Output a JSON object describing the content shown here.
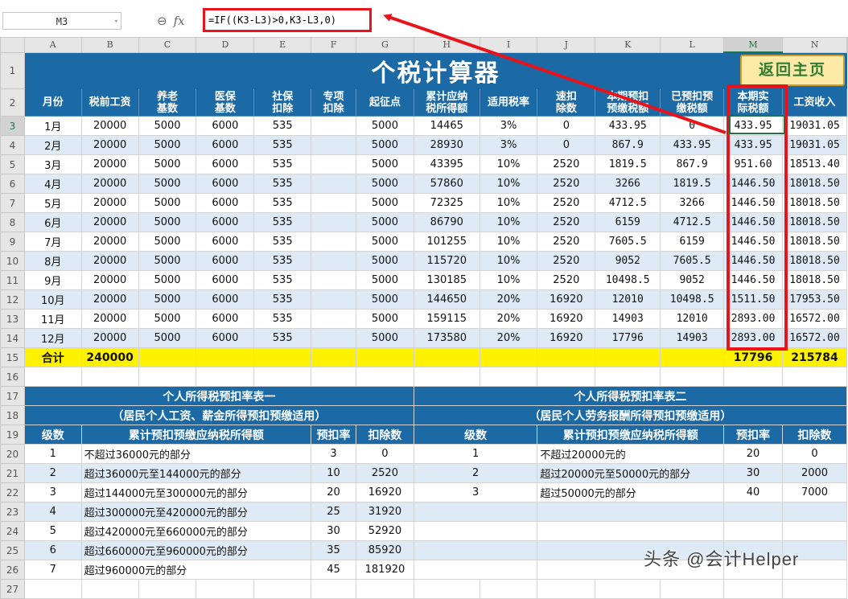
{
  "formula_bar": {
    "name_box": "M3",
    "formula": "=IF((K3-L3)>0,K3-L3,0)"
  },
  "columns": [
    "A",
    "B",
    "C",
    "D",
    "E",
    "F",
    "G",
    "H",
    "I",
    "J",
    "K",
    "L",
    "M",
    "N"
  ],
  "rows": [
    "1",
    "2",
    "3",
    "4",
    "5",
    "6",
    "7",
    "8",
    "9",
    "10",
    "11",
    "12",
    "13",
    "14",
    "15",
    "16",
    "17",
    "18",
    "19",
    "20",
    "21",
    "22",
    "23",
    "24",
    "25",
    "26",
    "27"
  ],
  "title": "个税计算器",
  "back_button": "返回主页",
  "headers": [
    "月份",
    "税前工资",
    "养老\n基数",
    "医保\n基数",
    "社保\n扣除",
    "专项\n扣除",
    "起征点",
    "累计应纳\n税所得额",
    "适用税率",
    "速扣\n除数",
    "本期预扣\n预缴税额",
    "已预扣预\n缴税额",
    "本期实\n际税额",
    "工资收入"
  ],
  "months": [
    [
      "1月",
      "20000",
      "5000",
      "6000",
      "535",
      "",
      "5000",
      "14465",
      "3%",
      "0",
      "433.95",
      "0",
      "433.95",
      "19031.05"
    ],
    [
      "2月",
      "20000",
      "5000",
      "6000",
      "535",
      "",
      "5000",
      "28930",
      "3%",
      "0",
      "867.9",
      "433.95",
      "433.95",
      "19031.05"
    ],
    [
      "3月",
      "20000",
      "5000",
      "6000",
      "535",
      "",
      "5000",
      "43395",
      "10%",
      "2520",
      "1819.5",
      "867.9",
      "951.60",
      "18513.40"
    ],
    [
      "4月",
      "20000",
      "5000",
      "6000",
      "535",
      "",
      "5000",
      "57860",
      "10%",
      "2520",
      "3266",
      "1819.5",
      "1446.50",
      "18018.50"
    ],
    [
      "5月",
      "20000",
      "5000",
      "6000",
      "535",
      "",
      "5000",
      "72325",
      "10%",
      "2520",
      "4712.5",
      "3266",
      "1446.50",
      "18018.50"
    ],
    [
      "6月",
      "20000",
      "5000",
      "6000",
      "535",
      "",
      "5000",
      "86790",
      "10%",
      "2520",
      "6159",
      "4712.5",
      "1446.50",
      "18018.50"
    ],
    [
      "7月",
      "20000",
      "5000",
      "6000",
      "535",
      "",
      "5000",
      "101255",
      "10%",
      "2520",
      "7605.5",
      "6159",
      "1446.50",
      "18018.50"
    ],
    [
      "8月",
      "20000",
      "5000",
      "6000",
      "535",
      "",
      "5000",
      "115720",
      "10%",
      "2520",
      "9052",
      "7605.5",
      "1446.50",
      "18018.50"
    ],
    [
      "9月",
      "20000",
      "5000",
      "6000",
      "535",
      "",
      "5000",
      "130185",
      "10%",
      "2520",
      "10498.5",
      "9052",
      "1446.50",
      "18018.50"
    ],
    [
      "10月",
      "20000",
      "5000",
      "6000",
      "535",
      "",
      "5000",
      "144650",
      "20%",
      "16920",
      "12010",
      "10498.5",
      "1511.50",
      "17953.50"
    ],
    [
      "11月",
      "20000",
      "5000",
      "6000",
      "535",
      "",
      "5000",
      "159115",
      "20%",
      "16920",
      "14903",
      "12010",
      "2893.00",
      "16572.00"
    ],
    [
      "12月",
      "20000",
      "5000",
      "6000",
      "535",
      "",
      "5000",
      "173580",
      "20%",
      "16920",
      "17796",
      "14903",
      "2893.00",
      "16572.00"
    ]
  ],
  "total": {
    "label": "合计",
    "pretax": "240000",
    "tax": "17796",
    "income": "215784"
  },
  "table1": {
    "title": "个人所得税预扣率表一",
    "subtitle": "（居民个人工资、薪金所得预扣预缴适用）",
    "headers": [
      "级数",
      "累计预扣预缴应纳税所得额",
      "预扣率",
      "扣除数"
    ],
    "rows": [
      [
        "1",
        "不超过36000元的部分",
        "3",
        "0"
      ],
      [
        "2",
        "超过36000元至144000元的部分",
        "10",
        "2520"
      ],
      [
        "3",
        "超过144000元至300000元的部分",
        "20",
        "16920"
      ],
      [
        "4",
        "超过300000元至420000元的部分",
        "25",
        "31920"
      ],
      [
        "5",
        "超过420000元至660000元的部分",
        "30",
        "52920"
      ],
      [
        "6",
        "超过660000元至960000元的部分",
        "35",
        "85920"
      ],
      [
        "7",
        "超过960000元的部分",
        "45",
        "181920"
      ]
    ]
  },
  "table2": {
    "title": "个人所得税预扣率表二",
    "subtitle": "（居民个人劳务报酬所得预扣预缴适用）",
    "headers": [
      "级数",
      "累计预扣预缴应纳税所得额",
      "预扣率",
      "扣除数"
    ],
    "rows": [
      [
        "1",
        "不超过20000元的",
        "20",
        "0"
      ],
      [
        "2",
        "超过20000元至50000元的部分",
        "30",
        "2000"
      ],
      [
        "3",
        "超过50000元的部分",
        "40",
        "7000"
      ]
    ]
  },
  "watermark": "头条 @会计Helper",
  "colors": {
    "header_blue": "#1b6aa5",
    "stripe": "#deeaf6",
    "total_yellow": "#fff200",
    "highlight_red": "#e8131b",
    "excel_green": "#217346"
  }
}
